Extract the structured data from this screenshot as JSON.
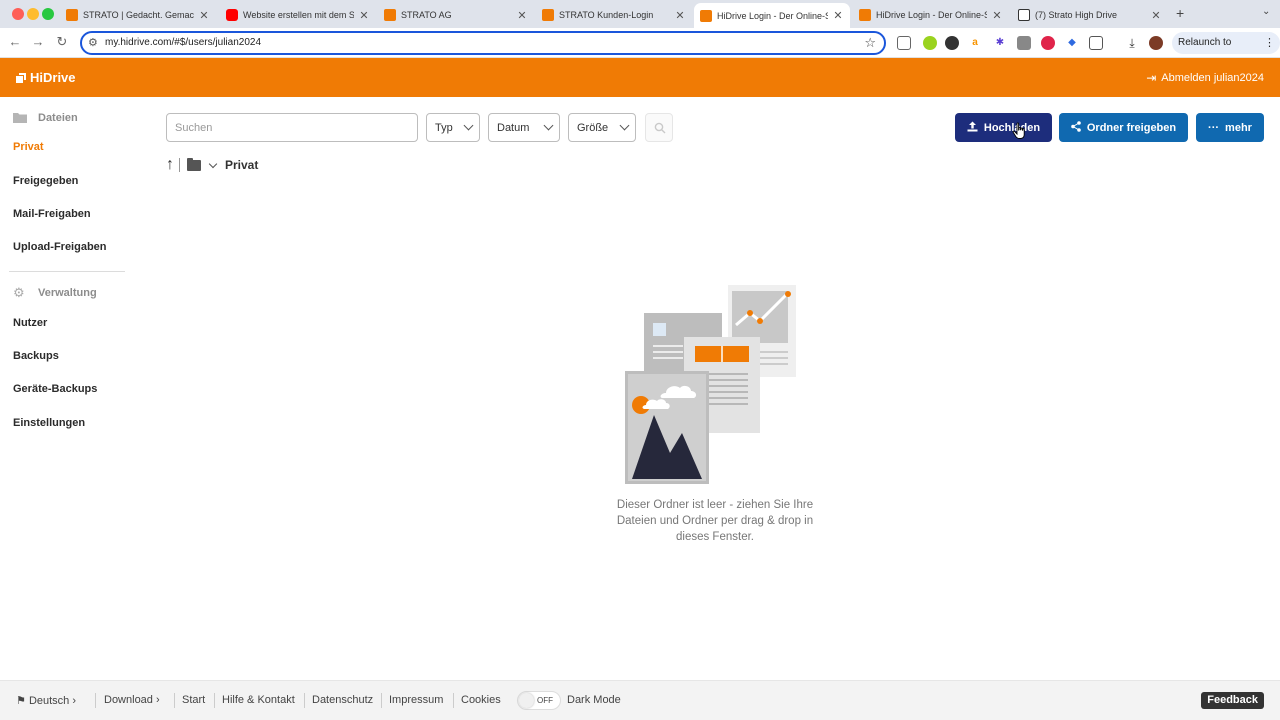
{
  "browser": {
    "tabs": [
      {
        "title": "STRATO | Gedacht. Gemacht.",
        "icon": "strato-favicon",
        "color": "#f07b05"
      },
      {
        "title": "Website erstellen mit dem ST",
        "icon": "youtube-favicon",
        "color": "#ff0000"
      },
      {
        "title": "STRATO AG",
        "icon": "strato-favicon",
        "color": "#f07b05"
      },
      {
        "title": "STRATO Kunden-Login",
        "icon": "strato-favicon",
        "color": "#f07b05"
      },
      {
        "title": "HiDrive Login - Der Online-Sp",
        "icon": "hidrive-favicon",
        "color": "#f07b05",
        "active": true
      },
      {
        "title": "HiDrive Login - Der Online-Sp",
        "icon": "hidrive-favicon",
        "color": "#f07b05"
      },
      {
        "title": "(7) Strato High Drive",
        "icon": "notion-favicon",
        "color": "#333333"
      }
    ],
    "url": "my.hidrive.com/#$/users/julian2024",
    "relaunch_label": "Relaunch to update"
  },
  "header": {
    "logo": "HiDrive",
    "logout_label": "Abmelden julian2024",
    "brand_color": "#f07b05"
  },
  "sidebar": {
    "files_group": "Dateien",
    "files_items": [
      "Privat",
      "Freigegeben",
      "Mail-Freigaben",
      "Upload-Freigaben"
    ],
    "admin_group": "Verwaltung",
    "admin_items": [
      "Nutzer",
      "Backups",
      "Geräte-Backups",
      "Einstellungen"
    ]
  },
  "filters": {
    "search_placeholder": "Suchen",
    "type_label": "Typ",
    "date_label": "Datum",
    "size_label": "Größe"
  },
  "actions": {
    "upload_label": "Hochladen",
    "share_label": "Ordner freigeben",
    "more_label": "mehr"
  },
  "breadcrumb": {
    "folder": "Privat"
  },
  "empty_state": {
    "message": "Dieser Ordner ist leer - ziehen Sie Ihre Dateien und Ordner per drag & drop in dieses Fenster."
  },
  "footer": {
    "language": "Deutsch",
    "links": [
      "Download",
      "Start",
      "Hilfe & Kontakt",
      "Datenschutz",
      "Impressum",
      "Cookies"
    ],
    "dark_mode_state": "OFF",
    "dark_mode_label": "Dark Mode",
    "feedback_label": "Feedback"
  }
}
